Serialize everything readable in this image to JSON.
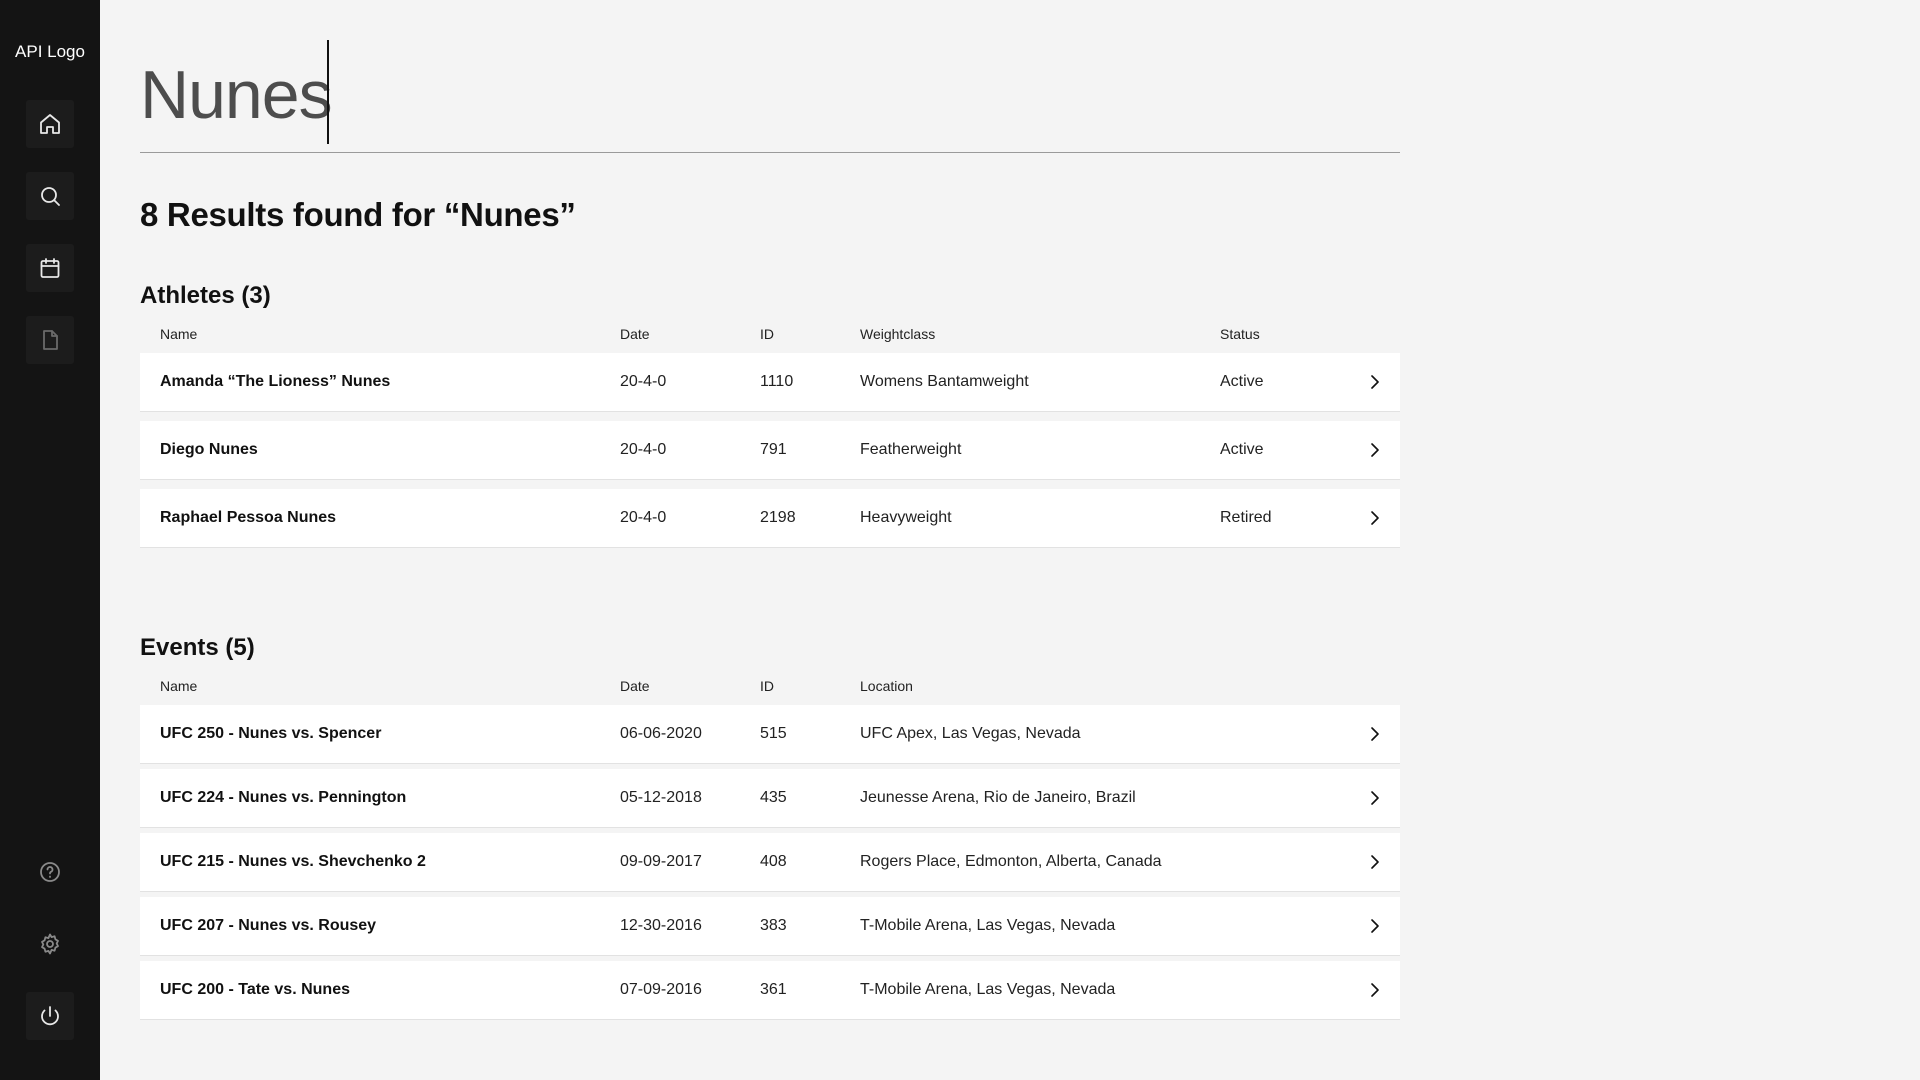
{
  "sidebar": {
    "logo": "API Logo",
    "nav": [
      {
        "icon": "home-icon"
      },
      {
        "icon": "search-icon"
      },
      {
        "icon": "calendar-icon"
      },
      {
        "icon": "document-icon"
      }
    ],
    "bottom": [
      {
        "icon": "help-icon"
      },
      {
        "icon": "gear-icon"
      },
      {
        "icon": "power-icon"
      }
    ]
  },
  "search": {
    "value": "Nunes"
  },
  "results_title": "8 Results found for “Nunes”",
  "athletes": {
    "title": "Athletes (3)",
    "columns": [
      "Name",
      "Date",
      "ID",
      "Weightclass",
      "Status"
    ],
    "rows": [
      {
        "name": "Amanda “The Lioness” Nunes",
        "date": "20-4-0",
        "id": "1110",
        "weightclass": "Womens Bantamweight",
        "status": "Active"
      },
      {
        "name": "Diego Nunes",
        "date": "20-4-0",
        "id": "791",
        "weightclass": "Featherweight",
        "status": "Active"
      },
      {
        "name": "Raphael Pessoa Nunes",
        "date": "20-4-0",
        "id": "2198",
        "weightclass": "Heavyweight",
        "status": "Retired"
      }
    ]
  },
  "events": {
    "title": "Events (5)",
    "columns": [
      "Name",
      "Date",
      "ID",
      "Location"
    ],
    "rows": [
      {
        "name": "UFC 250 - Nunes vs. Spencer",
        "date": "06-06-2020",
        "id": "515",
        "location": "UFC Apex, Las Vegas, Nevada"
      },
      {
        "name": "UFC 224 - Nunes vs. Pennington",
        "date": "05-12-2018",
        "id": "435",
        "location": "Jeunesse Arena, Rio de Janeiro, Brazil"
      },
      {
        "name": "UFC 215 - Nunes vs. Shevchenko 2",
        "date": "09-09-2017",
        "id": "408",
        "location": "Rogers Place, Edmonton, Alberta, Canada"
      },
      {
        "name": "UFC 207 - Nunes vs. Rousey",
        "date": "12-30-2016",
        "id": "383",
        "location": "T-Mobile Arena, Las Vegas, Nevada"
      },
      {
        "name": "UFC 200 - Tate vs. Nunes",
        "date": "07-09-2016",
        "id": "361",
        "location": "T-Mobile Arena, Las Vegas, Nevada"
      }
    ]
  }
}
